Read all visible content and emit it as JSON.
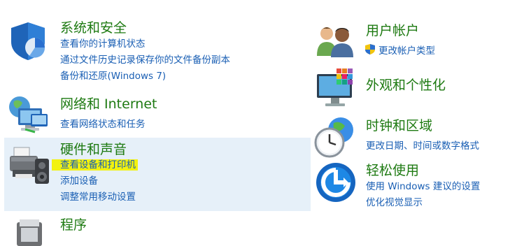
{
  "left": {
    "system": {
      "title": "系统和安全",
      "links": [
        "查看你的计算机状态",
        "通过文件历史记录保存你的文件备份副本",
        "备份和还原(Windows 7)"
      ]
    },
    "network": {
      "title": "网络和 Internet",
      "links": [
        "查看网络状态和任务"
      ]
    },
    "hardware": {
      "title": "硬件和声音",
      "links": [
        "查看设备和打印机",
        "添加设备",
        "调整常用移动设置"
      ]
    },
    "programs": {
      "title": "程序"
    }
  },
  "right": {
    "accounts": {
      "title": "用户帐户",
      "links": [
        "更改帐户类型"
      ]
    },
    "appearance": {
      "title": "外观和个性化"
    },
    "clock": {
      "title": "时钟和区域",
      "links": [
        "更改日期、时间或数字格式"
      ]
    },
    "ease": {
      "title": "轻松使用",
      "links": [
        "使用 Windows 建议的设置",
        "优化视觉显示"
      ]
    }
  },
  "colors": {
    "title_green": "#1e7a12",
    "link_blue": "#1a5fb4",
    "hover_bg": "#e6f0f9",
    "highlight": "#f2f20f"
  }
}
